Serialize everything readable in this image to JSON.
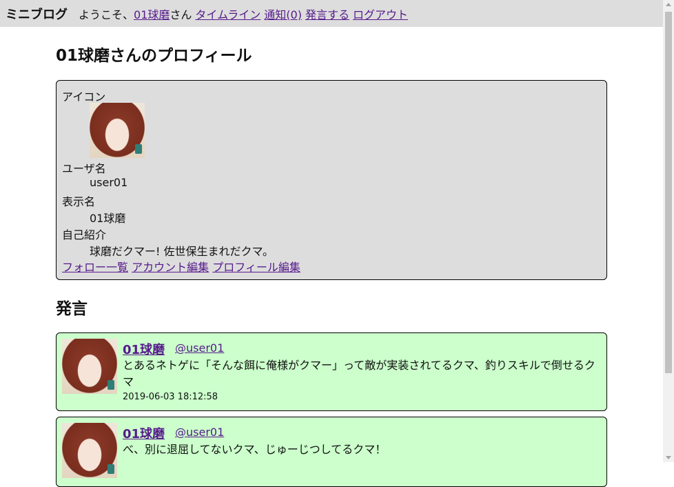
{
  "header": {
    "brand": "ミニブログ",
    "welcome_prefix": "ようこそ、",
    "user_link": "01球磨",
    "welcome_suffix": "さん",
    "nav": [
      "タイムライン",
      "通知(0)",
      "発言する",
      "ログアウト"
    ]
  },
  "profile": {
    "title": "01球磨さんのプロフィール",
    "icon_label": "アイコン",
    "username_label": "ユーザ名",
    "username": "user01",
    "display_name_label": "表示名",
    "display_name": "01球磨",
    "bio_label": "自己紹介",
    "bio": "球磨だクマー! 佐世保生まれだクマ。",
    "links": [
      "フォロー一覧",
      "アカウント編集",
      "プロフィール編集"
    ]
  },
  "posts_section": {
    "title": "発言",
    "posts": [
      {
        "name": "01球磨",
        "handle": "@user01",
        "body": "とあるネトゲに「そんな餌に俺様がクマー」って敵が実装されてるクマ、釣りスキルで倒せるクマ",
        "time": "2019-06-03 18:12:58"
      },
      {
        "name": "01球磨",
        "handle": "@user01",
        "body": "べ、別に退屈してないクマ、じゅーじつしてるクマ！",
        "time": ""
      }
    ]
  },
  "colors": {
    "header_bg": "#dddddd",
    "profile_bg": "#dddddd",
    "post_bg": "#ccffcc",
    "link": "#551a8b"
  }
}
